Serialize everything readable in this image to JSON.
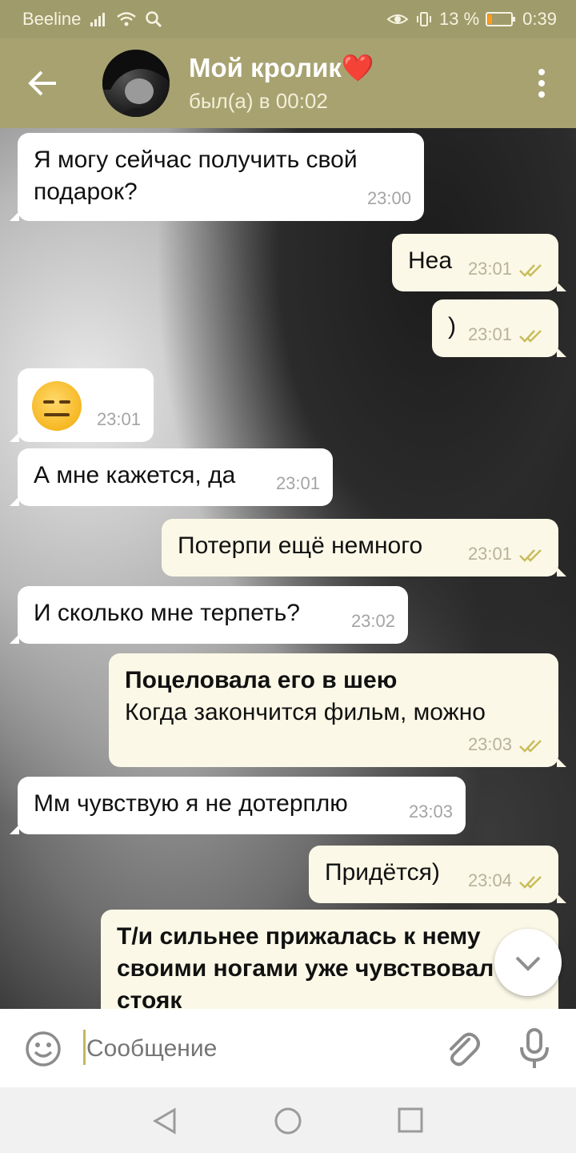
{
  "status_bar": {
    "carrier": "Beeline",
    "battery_percent": "13 %",
    "time": "0:39",
    "icons": [
      "signal-icon",
      "wifi-icon",
      "search-icon",
      "eye-icon",
      "vibrate-icon",
      "battery-icon"
    ]
  },
  "header": {
    "title": "Мой кролик❤️",
    "status": "был(а) в 00:02"
  },
  "messages": [
    {
      "dir": "in",
      "text": "Я могу сейчас получить свой подарок?",
      "line1": "Я могу сейчас получить свой",
      "line2": "подарок?",
      "time": "23:00"
    },
    {
      "dir": "out",
      "text": "Неа",
      "time": "23:01",
      "read": true
    },
    {
      "dir": "out",
      "text": ")",
      "time": "23:01",
      "read": true
    },
    {
      "dir": "in",
      "text": "😑",
      "emoji": "expressionless-face",
      "time": "23:01"
    },
    {
      "dir": "in",
      "text": "А мне кажется, да",
      "time": "23:01"
    },
    {
      "dir": "out",
      "text": "Потерпи ещё немного",
      "time": "23:01",
      "read": true
    },
    {
      "dir": "in",
      "text": "И сколько мне терпеть?",
      "time": "23:02"
    },
    {
      "dir": "out",
      "bold": "Поцеловала его в шею",
      "text": "Когда закончится фильм, можно",
      "time": "23:03",
      "read": true
    },
    {
      "dir": "in",
      "text": "Мм чувствую я не дотерплю",
      "time": "23:03"
    },
    {
      "dir": "out",
      "text": "Придётся)",
      "time": "23:04",
      "read": true
    },
    {
      "dir": "out",
      "bold_line1": "Т/и сильнее прижалась к нему",
      "bold_line2": "своими ногами уже чувствовал",
      "bold_line3": "стояк",
      "time": "",
      "read": true
    }
  ],
  "input": {
    "placeholder": "Сообщение"
  },
  "colors": {
    "header": "#a8a271",
    "status_bar": "#a09b6a",
    "incoming": "#ffffff",
    "outgoing": "#fbf8e7",
    "check": "#c9bd5b",
    "caret": "#c5b560"
  }
}
